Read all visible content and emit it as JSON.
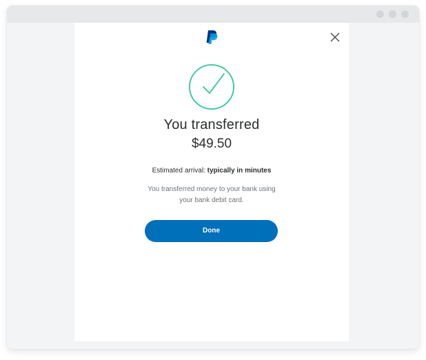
{
  "modal": {
    "headline": "You transferred",
    "amount": "$49.50",
    "arrival_label": "Estimated arrival:",
    "arrival_value": "typically in minutes",
    "info": "You transferred money to your bank using your bank debit card.",
    "done_label": "Done",
    "icons": {
      "logo": "paypal-logo",
      "close": "close-icon",
      "success": "checkmark-circle-icon"
    }
  },
  "colors": {
    "brand_blue": "#0070ba",
    "logo_dark": "#003087",
    "logo_light": "#009cde",
    "success_green": "#2ec5a0",
    "text_dark": "#2c2e2f",
    "text_muted": "#6c7378",
    "background": "#f2f4f6"
  }
}
